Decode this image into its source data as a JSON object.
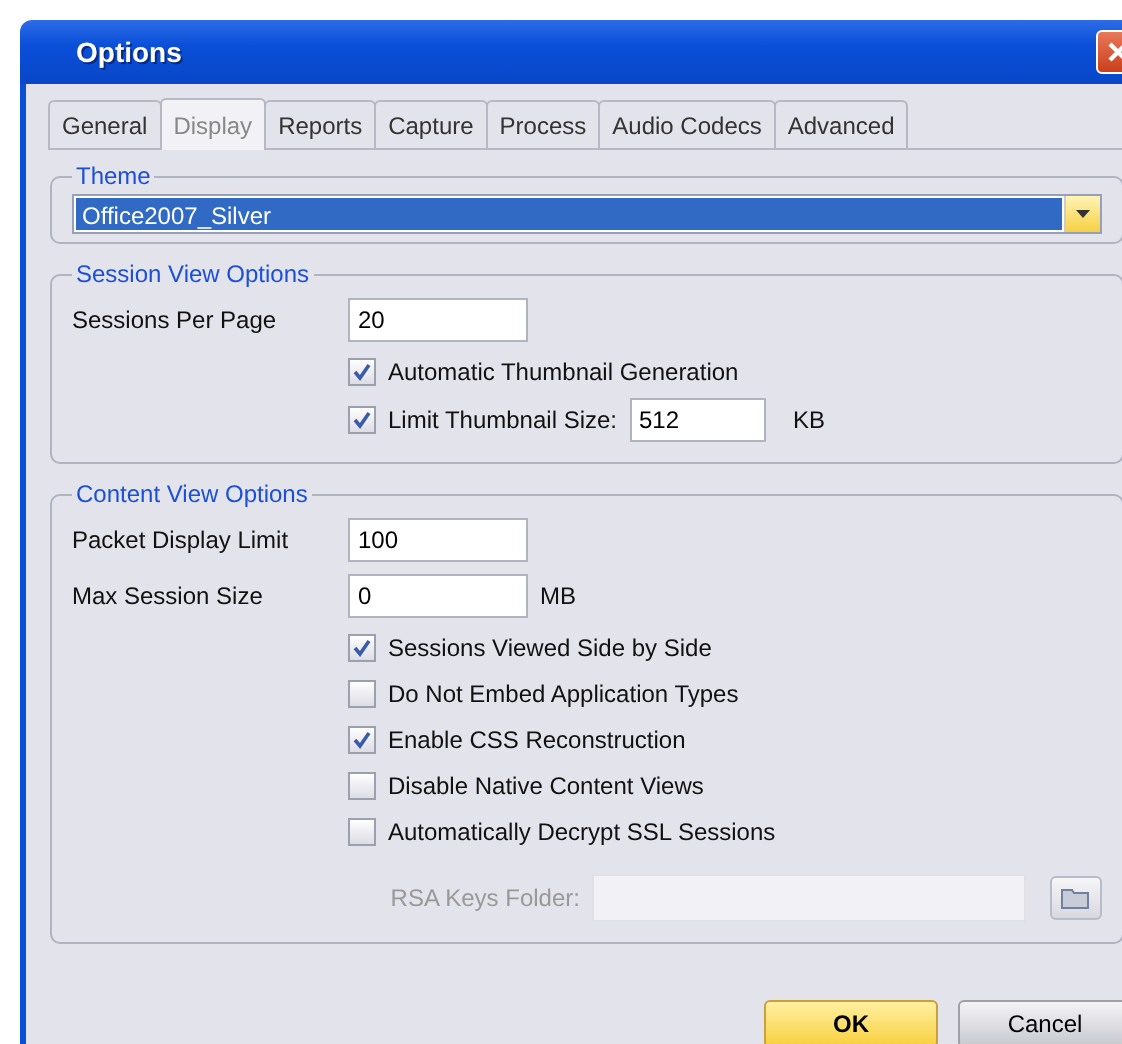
{
  "window": {
    "title": "Options"
  },
  "tabs": [
    {
      "label": "General",
      "selected": false
    },
    {
      "label": "Display",
      "selected": true
    },
    {
      "label": "Reports",
      "selected": false
    },
    {
      "label": "Capture",
      "selected": false
    },
    {
      "label": "Process",
      "selected": false
    },
    {
      "label": "Audio Codecs",
      "selected": false
    },
    {
      "label": "Advanced",
      "selected": false
    }
  ],
  "theme": {
    "legend": "Theme",
    "value": "Office2007_Silver"
  },
  "groups": [
    {
      "legend": "Session View Options",
      "items": [
        {
          "kind": "field",
          "label": "Sessions Per Page",
          "value": "20"
        },
        {
          "kind": "checkbox",
          "label": "Automatic Thumbnail Generation",
          "checked": true
        },
        {
          "kind": "checkbox_field",
          "label": "Limit Thumbnail Size:",
          "checked": true,
          "value": "512",
          "unit": "KB"
        }
      ]
    },
    {
      "legend": "Content View Options",
      "items": [
        {
          "kind": "field",
          "label": "Packet Display Limit",
          "value": "100"
        },
        {
          "kind": "field",
          "label": "Max Session Size",
          "value": "0",
          "unit": "MB"
        },
        {
          "kind": "checkbox",
          "label": "Sessions Viewed Side by Side",
          "checked": true
        },
        {
          "kind": "checkbox",
          "label": "Do Not Embed Application Types",
          "checked": false
        },
        {
          "kind": "checkbox",
          "label": "Enable CSS Reconstruction",
          "checked": true
        },
        {
          "kind": "checkbox",
          "label": "Disable Native Content Views",
          "checked": false
        },
        {
          "kind": "checkbox",
          "label": "Automatically Decrypt SSL Sessions",
          "checked": false
        },
        {
          "kind": "folder",
          "label": "RSA Keys Folder:",
          "disabled": true
        }
      ]
    }
  ],
  "buttons": [
    {
      "label": "OK",
      "default": true
    },
    {
      "label": "Cancel",
      "default": false
    }
  ]
}
